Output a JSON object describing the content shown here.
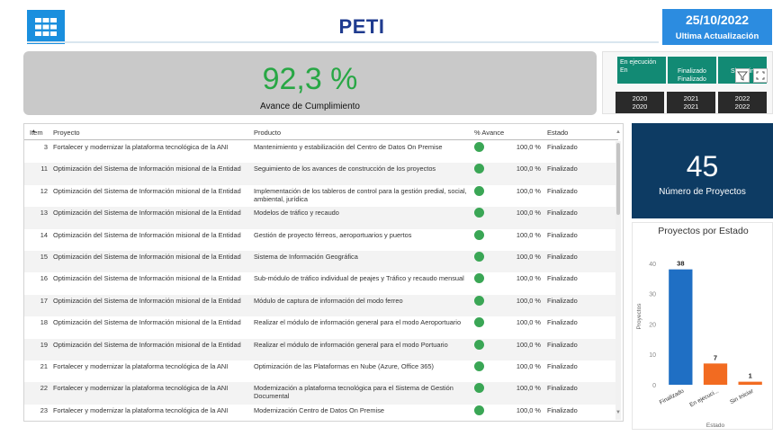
{
  "header": {
    "title": "PETI",
    "date": "25/10/2022",
    "update_label": "Ultima Actualización",
    "menu_icon": "grid-icon",
    "accent": "#2c8ce0"
  },
  "kpi": {
    "value": "92,3 %",
    "label": "Avance de Cumplimiento",
    "value_color": "#28a745"
  },
  "filters": {
    "states": [
      "En ejecución En",
      "Finalizado Finalizado",
      "Sin I Sin"
    ],
    "years": [
      {
        "top": "2020",
        "bottom": "2020"
      },
      {
        "top": "2021",
        "bottom": "2021"
      },
      {
        "top": "2022",
        "bottom": "2022"
      }
    ],
    "icons": [
      "filter-icon",
      "expand-icon"
    ]
  },
  "table": {
    "headers": {
      "item": "Item",
      "proyecto": "Proyecto",
      "producto": "Producto",
      "avance": "% Avance",
      "estado": "Estado"
    },
    "rows": [
      {
        "item": "3",
        "proyecto": "Fortalecer y modernizar la plataforma tecnológica de la ANI",
        "producto": "Mantenimiento y estabilización del Centro de Datos On Premise",
        "avance": "100,0 %",
        "estado": "Finalizado"
      },
      {
        "item": "11",
        "proyecto": "Optimización del Sistema de Información misional de la Entidad",
        "producto": "Seguimiento de los avances de construcción de los proyectos",
        "avance": "100,0 %",
        "estado": "Finalizado"
      },
      {
        "item": "12",
        "proyecto": "Optimización del Sistema de Información misional de la Entidad",
        "producto": "Implementación de los tableros de control para la gestión predial, social, ambiental, jurídica",
        "avance": "100,0 %",
        "estado": "Finalizado"
      },
      {
        "item": "13",
        "proyecto": "Optimización del Sistema de Información misional de la Entidad",
        "producto": "Modelos de tráfico y recaudo",
        "avance": "100,0 %",
        "estado": "Finalizado"
      },
      {
        "item": "14",
        "proyecto": "Optimización del Sistema de Información misional de la Entidad",
        "producto": "Gestión de proyecto férreos, aeroportuarios y puertos",
        "avance": "100,0 %",
        "estado": "Finalizado"
      },
      {
        "item": "15",
        "proyecto": "Optimización del Sistema de Información misional de la Entidad",
        "producto": "Sistema de Información Geográfica",
        "avance": "100,0 %",
        "estado": "Finalizado"
      },
      {
        "item": "16",
        "proyecto": "Optimización del Sistema de Información misional de la Entidad",
        "producto": "Sub-módulo de tráfico individual de peajes y Tráfico y recaudo mensual",
        "avance": "100,0 %",
        "estado": "Finalizado"
      },
      {
        "item": "17",
        "proyecto": "Optimización del Sistema de Información misional de la Entidad",
        "producto": "Módulo de captura de información del modo ferreo",
        "avance": "100,0 %",
        "estado": "Finalizado"
      },
      {
        "item": "18",
        "proyecto": "Optimización del Sistema de Información misional de la Entidad",
        "producto": "Realizar el módulo de información general para el modo Aeroportuario",
        "avance": "100,0 %",
        "estado": "Finalizado"
      },
      {
        "item": "19",
        "proyecto": "Optimización del Sistema de Información misional de la Entidad",
        "producto": "Realizar el módulo de información general para el modo Portuario",
        "avance": "100,0 %",
        "estado": "Finalizado"
      },
      {
        "item": "21",
        "proyecto": "Fortalecer y modernizar la plataforma tecnológica de la ANI",
        "producto": "Optimización de las Plataformas en Nube (Azure, Office 365)",
        "avance": "100,0 %",
        "estado": "Finalizado"
      },
      {
        "item": "22",
        "proyecto": "Fortalecer y modernizar la plataforma tecnológica de la ANI",
        "producto": "Modernización a plataforma tecnológica para el Sistema de Gestión Documental",
        "avance": "100,0 %",
        "estado": "Finalizado"
      },
      {
        "item": "23",
        "proyecto": "Fortalecer y modernizar la plataforma tecnológica de la ANI",
        "producto": "Modernización Centro de Datos On Premise",
        "avance": "100,0 %",
        "estado": "Finalizado"
      }
    ]
  },
  "count": {
    "value": "45",
    "label": "Número de Proyectos"
  },
  "chart_data": {
    "type": "bar",
    "title": "Proyectos por Estado",
    "xlabel": "Estado",
    "ylabel": "Proyectos",
    "categories": [
      "Finalizado",
      "En ejecuci...",
      "Sin Iniciar"
    ],
    "values": [
      38,
      7,
      1
    ],
    "colors": [
      "#1f6fc4",
      "#f26b21",
      "#f26b21"
    ],
    "ylim": [
      0,
      45
    ],
    "yticks": [
      0,
      10,
      20,
      30,
      40
    ],
    "data_labels": true
  }
}
